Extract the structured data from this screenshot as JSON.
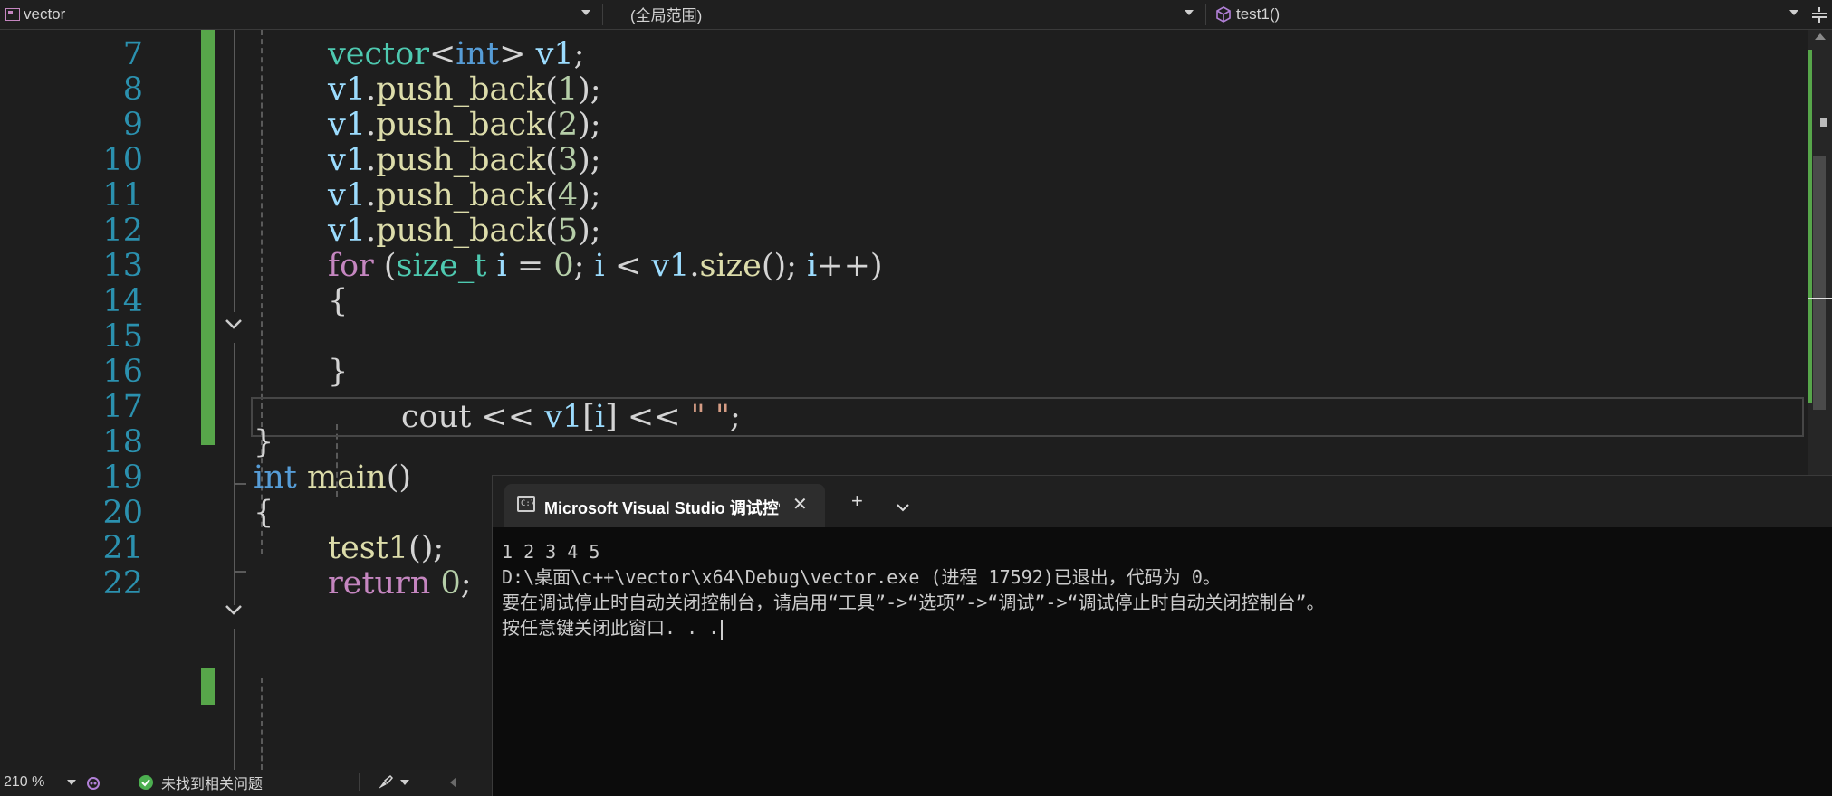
{
  "nav": {
    "project": "vector",
    "scope": "(全局范围)",
    "member": "test1()"
  },
  "editor": {
    "line_numbers": [
      "7",
      "8",
      "9",
      "10",
      "11",
      "12",
      "13",
      "14",
      "15",
      "16",
      "17",
      "18",
      "19",
      "20",
      "21",
      "22"
    ],
    "code": {
      "l7": [
        "vector",
        "<",
        "int",
        ">",
        " v1",
        ";"
      ],
      "l8": [
        "v1",
        ".",
        "push_back",
        "(",
        "1",
        ");"
      ],
      "l9": [
        "v1",
        ".",
        "push_back",
        "(",
        "2",
        ");"
      ],
      "l10": [
        "v1",
        ".",
        "push_back",
        "(",
        "3",
        ");"
      ],
      "l11": [
        "v1",
        ".",
        "push_back",
        "(",
        "4",
        ");"
      ],
      "l12": [
        "v1",
        ".",
        "push_back",
        "(",
        "5",
        ");"
      ],
      "l13": [
        "for",
        " (",
        "size_t",
        " i",
        " = ",
        "0",
        "; ",
        "i",
        " < ",
        "v1",
        ".",
        "size",
        "(); ",
        "i",
        "++)"
      ],
      "l14": "{",
      "l15": [
        "cout",
        " << ",
        "v1",
        "[",
        "i",
        "] << ",
        "\" \"",
        ";"
      ],
      "l16": "}",
      "l18": "}",
      "l19": [
        "int",
        " main",
        "()"
      ],
      "l20": "{",
      "l21": [
        "test1",
        "();"
      ],
      "l22": [
        "return",
        " ",
        "0",
        ";"
      ]
    }
  },
  "status": {
    "zoom": "210 %",
    "issues": "未找到相关问题"
  },
  "terminal": {
    "tab_title": "Microsoft Visual Studio 调试控制台",
    "lines": [
      "1 2 3 4 5",
      "D:\\桌面\\c++\\vector\\x64\\Debug\\vector.exe (进程 17592)已退出，代码为 0。",
      "要在调试停止时自动关闭控制台，请启用“工具”->“选项”->“调试”->“调试停止时自动关闭控制台”。",
      "按任意键关闭此窗口. . ."
    ]
  }
}
